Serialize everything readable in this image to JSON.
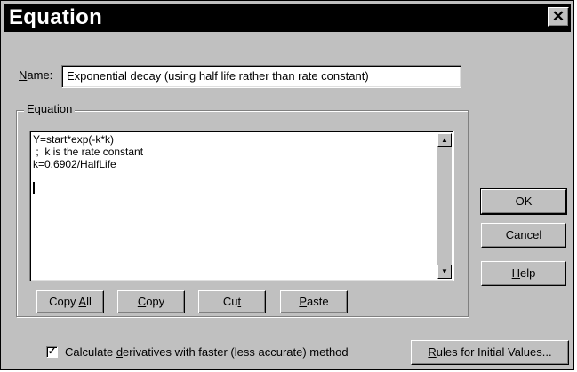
{
  "window": {
    "title": "Equation",
    "close_glyph": "✕"
  },
  "name_field": {
    "label_mnemonic": "N",
    "label_rest": "ame:",
    "value": "Exponential decay (using half life rather than rate constant)"
  },
  "equation_group": {
    "label": "Equation",
    "lines": [
      "Y=start*exp(-k*k)",
      " ;  k is the rate constant",
      "k=0.6902/HalfLife"
    ],
    "scroll_up_glyph": "▲",
    "scroll_down_glyph": "▼"
  },
  "edit_buttons": [
    {
      "pre": "Copy ",
      "mnemonic": "A",
      "post": "ll"
    },
    {
      "pre": "",
      "mnemonic": "C",
      "post": "opy"
    },
    {
      "pre": "Cu",
      "mnemonic": "t",
      "post": ""
    },
    {
      "pre": "",
      "mnemonic": "P",
      "post": "aste"
    }
  ],
  "dialog_buttons": {
    "ok": "OK",
    "cancel": "Cancel",
    "help_mnemonic": "H",
    "help_rest": "elp",
    "rules_mnemonic": "R",
    "rules_rest": "ules for Initial Values..."
  },
  "derivatives_checkbox": {
    "checked": true,
    "check_glyph": "✓",
    "label_pre": "Calculate ",
    "label_mnemonic": "d",
    "label_post": "erivatives with faster (less accurate) method"
  },
  "icons": [
    "close-icon",
    "scroll-up-icon",
    "scroll-down-icon",
    "checkmark-icon"
  ]
}
